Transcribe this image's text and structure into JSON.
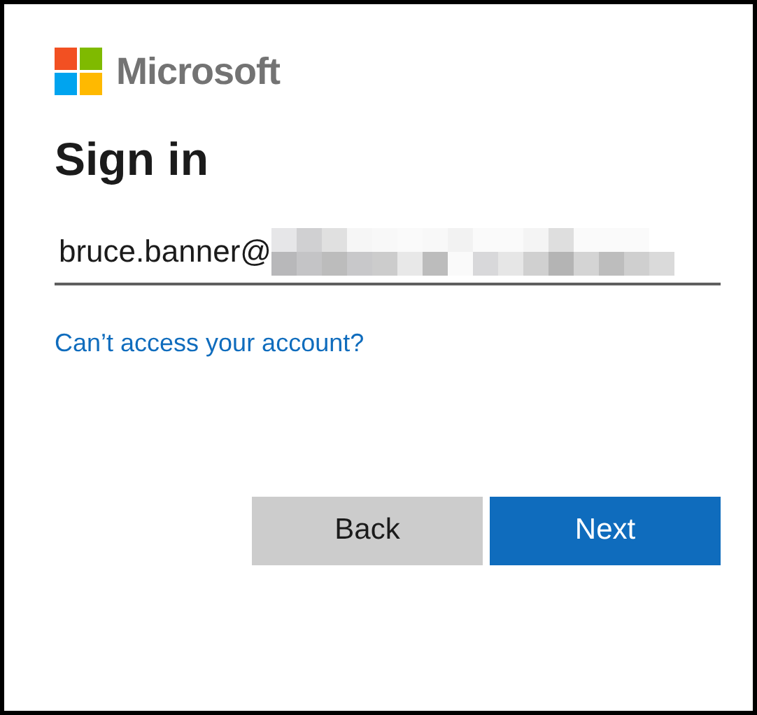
{
  "brand": {
    "name": "Microsoft"
  },
  "title": "Sign in",
  "email_field": {
    "value": "bruce.banner@"
  },
  "link": "Can’t access your account?",
  "buttons": [
    {
      "label": "Back",
      "kind": "secondary"
    },
    {
      "label": "Next",
      "kind": "primary"
    }
  ]
}
